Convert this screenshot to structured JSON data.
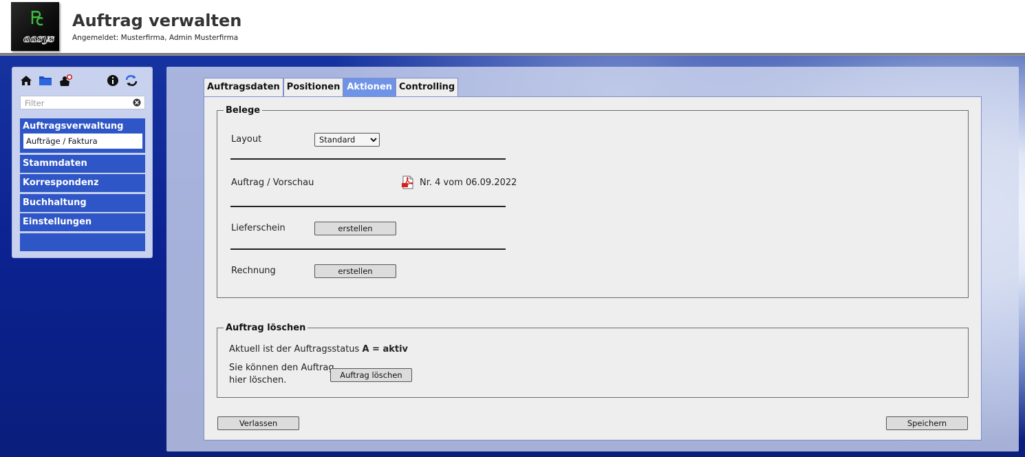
{
  "header": {
    "logo_text": "aasys",
    "title": "Auftrag verwalten",
    "login_info": "Angemeldet: Musterfirma, Admin Musterfirma"
  },
  "sidebar": {
    "icons": [
      "home-icon",
      "folder-icon",
      "user-logout-icon",
      "info-icon",
      "refresh-icon"
    ],
    "filter_placeholder": "Filter",
    "groups": [
      {
        "label": "Auftragsverwaltung",
        "sub_items": [
          "Aufträge / Faktura"
        ]
      },
      {
        "label": "Stammdaten"
      },
      {
        "label": "Korrespondenz"
      },
      {
        "label": "Buchhaltung"
      },
      {
        "label": "Einstellungen"
      }
    ]
  },
  "tabs": [
    {
      "label": "Auftragsdaten",
      "active": false
    },
    {
      "label": "Positionen",
      "active": false
    },
    {
      "label": "Aktionen",
      "active": true
    },
    {
      "label": "Controlling",
      "active": false
    }
  ],
  "belege": {
    "legend": "Belege",
    "layout_label": "Layout",
    "layout_value": "Standard",
    "preview_label": "Auftrag / Vorschau",
    "preview_link": "Nr. 4 vom 06.09.2022",
    "lieferschein_label": "Lieferschein",
    "lieferschein_button": "erstellen",
    "rechnung_label": "Rechnung",
    "rechnung_button": "erstellen"
  },
  "loeschen": {
    "legend": "Auftrag löschen",
    "status_prefix": "Aktuell ist der Auftragsstatus ",
    "status_value": "A = aktiv",
    "hint_line1": "Sie können den Auftrag",
    "hint_line2": "hier löschen.",
    "delete_button": "Auftrag löschen"
  },
  "footer": {
    "leave_button": "Verlassen",
    "save_button": "Speichern"
  },
  "colors": {
    "nav_blue": "#2f56c6",
    "active_tab": "#6f93e6",
    "pdf_red": "#d32020"
  }
}
